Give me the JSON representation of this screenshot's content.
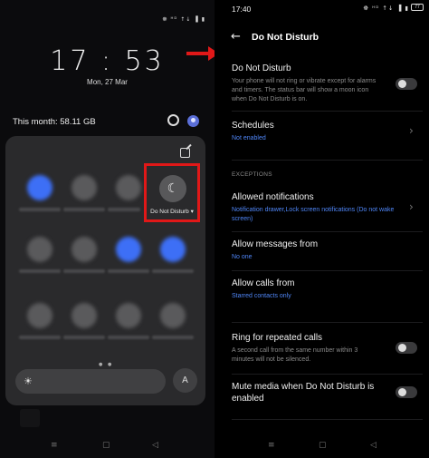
{
  "left": {
    "clock": "17 : 53",
    "date": "Mon, 27 Mar",
    "month_usage": "This month: 58.11 GB",
    "status_icons": "☸ ᴴᴰ ↑↓ ▐ ▮",
    "dnd_tile_label": "Do Not Disturb ▾",
    "auto_brightness": "A",
    "page_dots": "● ●",
    "icons": {
      "settings": "gear-icon",
      "user": "user-icon",
      "edit": "edit-icon",
      "moon": "moon-icon",
      "sun": "sun-icon"
    }
  },
  "right": {
    "time": "17:40",
    "status_icons": "☸ ᴴᴰ ↑↓ ▐ ▮",
    "battery": "77",
    "title": "Do Not Disturb",
    "dnd": {
      "title": "Do Not Disturb",
      "description": "Your phone will not ring or vibrate except for alarms and timers. The status bar will show a moon icon when Do Not Disturb is on."
    },
    "schedules": {
      "title": "Schedules",
      "value": "Not enabled"
    },
    "exceptions_header": "EXCEPTIONS",
    "allowed_notifications": {
      "title": "Allowed notifications",
      "value": "Notification drawer,Lock screen notifications (Do not wake screen)"
    },
    "allow_messages": {
      "title": "Allow messages from",
      "value": "No one"
    },
    "allow_calls": {
      "title": "Allow calls from",
      "value": "Starred contacts only"
    },
    "ring_repeated": {
      "title": "Ring for repeated calls",
      "description": "A second call from the same number within 3 minutes will not be silenced."
    },
    "mute_media": {
      "title": "Mute media when Do Not Disturb is enabled"
    }
  },
  "nav": {
    "menu": "≡",
    "home": "▢",
    "back": "◁"
  },
  "colors": {
    "accent_blue": "#4f86f7",
    "tile_blue": "#3d6ff6",
    "highlight_red": "#e01818"
  }
}
